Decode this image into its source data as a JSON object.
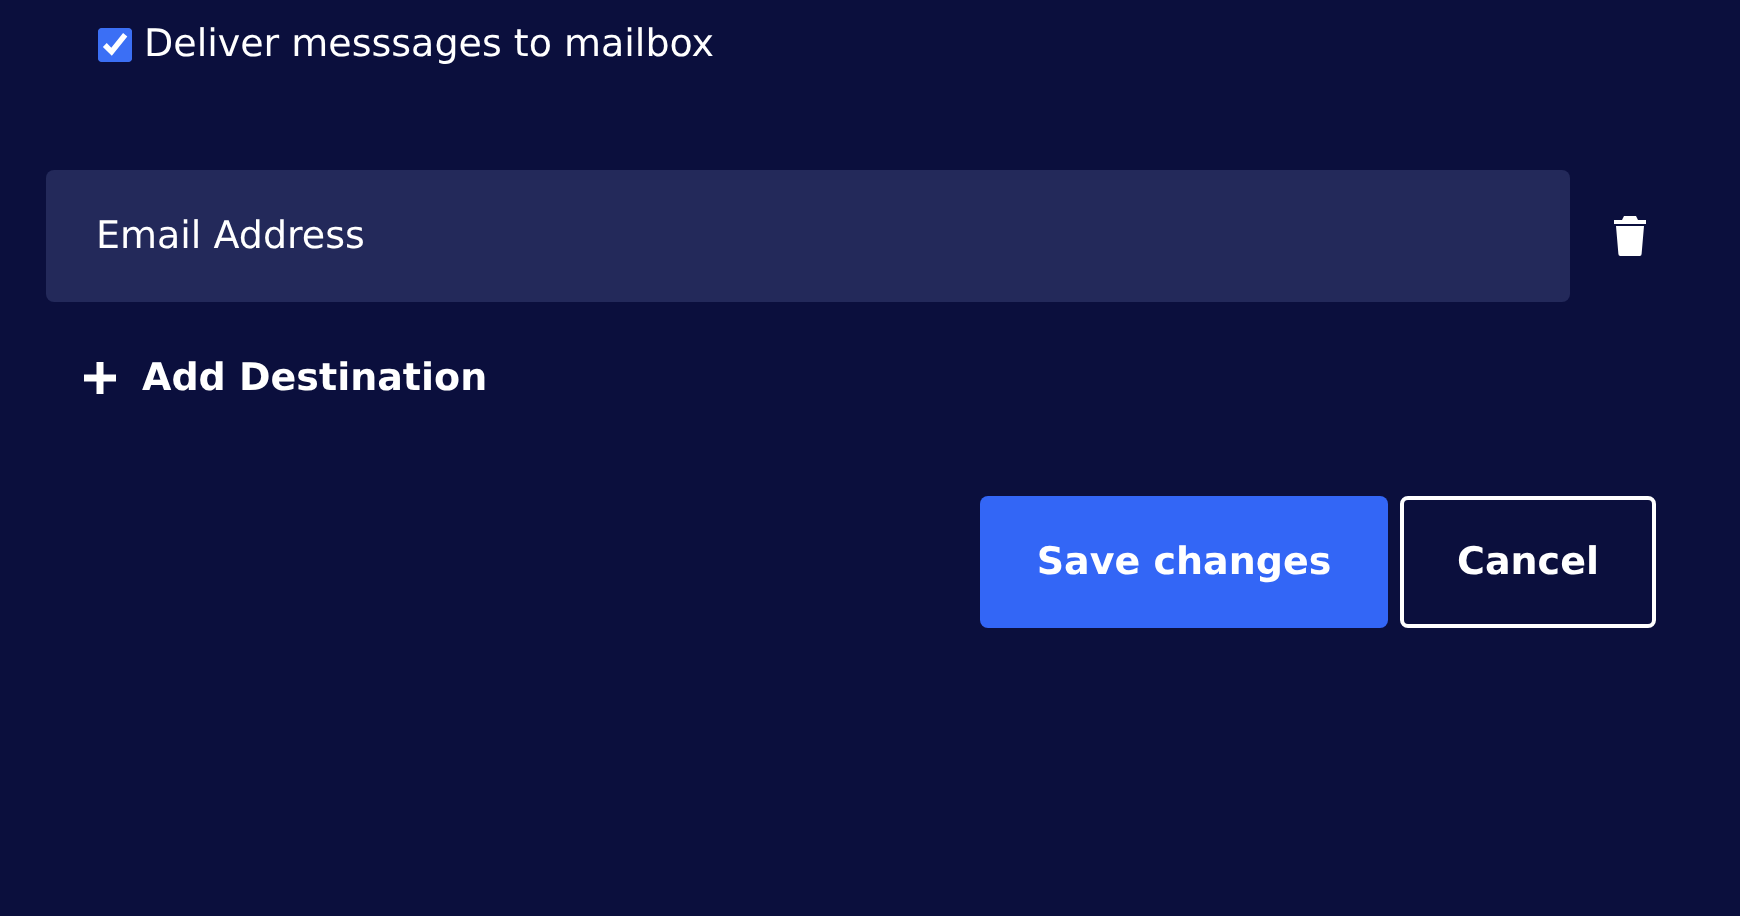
{
  "deliver_option": {
    "label": "Deliver messsages to mailbox",
    "checked": true
  },
  "destinations": [
    {
      "placeholder": "Email Address"
    }
  ],
  "add_destination": {
    "label": "Add Destination"
  },
  "buttons": [
    {
      "label": "Save changes",
      "kind": "primary"
    },
    {
      "label": "Cancel",
      "kind": "secondary"
    }
  ]
}
